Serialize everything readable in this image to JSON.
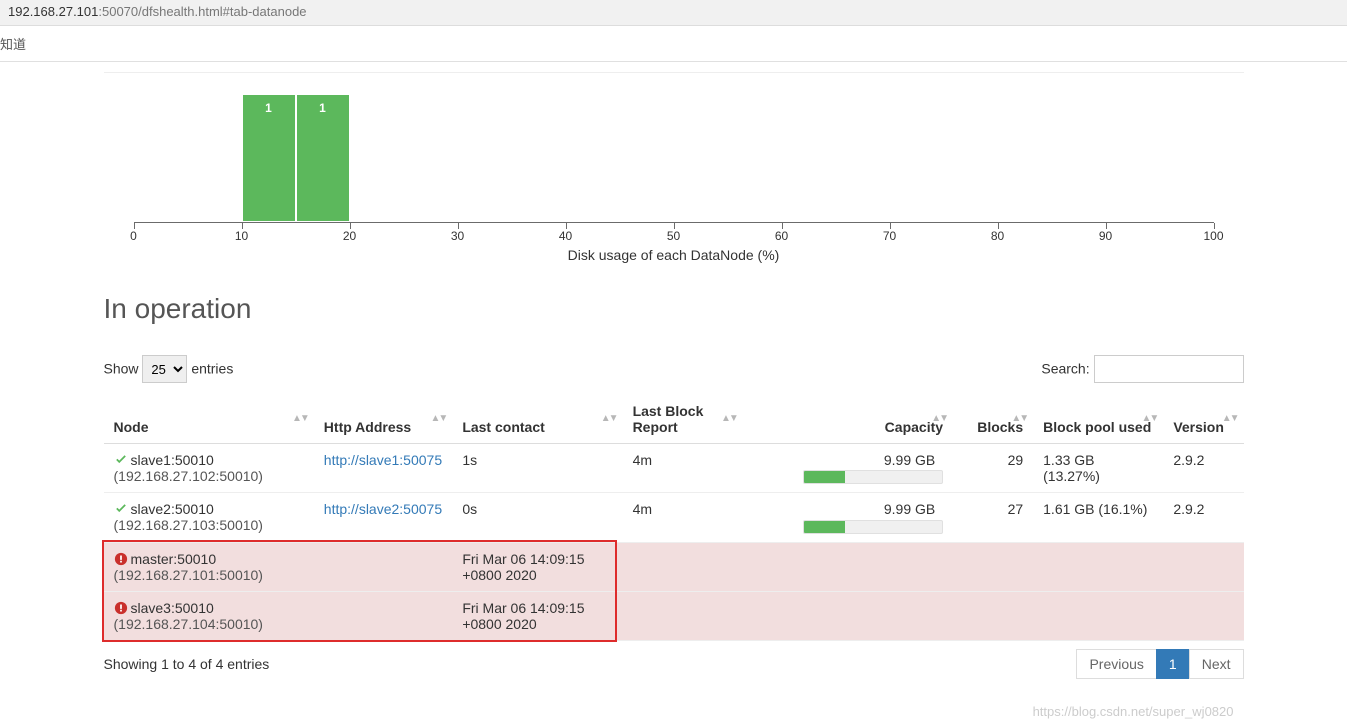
{
  "browser": {
    "url_host": "192.168.27.101",
    "url_path": ":50070/dfshealth.html#tab-datanode",
    "bookmark_fragment": "知道"
  },
  "chart_data": {
    "type": "bar",
    "title": "Disk usage of each DataNode (%)",
    "xlabel": "",
    "ylabel": "",
    "xlim": [
      0,
      100
    ],
    "x_ticks": [
      0,
      10,
      20,
      30,
      40,
      50,
      60,
      70,
      80,
      90,
      100
    ],
    "ylim": [
      0,
      1
    ],
    "bins": [
      {
        "x0": 10,
        "x1": 15,
        "count": 1
      },
      {
        "x0": 15,
        "x1": 20,
        "count": 1
      }
    ]
  },
  "section_title": "In operation",
  "table_controls": {
    "show_label_pre": "Show",
    "show_value": "25",
    "show_label_post": "entries",
    "search_label": "Search:",
    "search_value": ""
  },
  "columns": {
    "node": "Node",
    "http": "Http Address",
    "last_contact": "Last contact",
    "last_block": "Last Block Report",
    "capacity": "Capacity",
    "blocks": "Blocks",
    "bp_used": "Block pool used",
    "version": "Version"
  },
  "rows": [
    {
      "status": "up",
      "node": "slave1:50010",
      "addr": "(192.168.27.102:50010)",
      "http": "http://slave1:50075",
      "last_contact": "1s",
      "last_block": "4m",
      "capacity": "9.99 GB",
      "cap_pct": 30,
      "blocks": "29",
      "bp_used": "1.33 GB (13.27%)",
      "version": "2.9.2"
    },
    {
      "status": "up",
      "node": "slave2:50010",
      "addr": "(192.168.27.103:50010)",
      "http": "http://slave2:50075",
      "last_contact": "0s",
      "last_block": "4m",
      "capacity": "9.99 GB",
      "cap_pct": 30,
      "blocks": "27",
      "bp_used": "1.61 GB (16.1%)",
      "version": "2.9.2"
    },
    {
      "status": "dead",
      "node": "master:50010",
      "addr": "(192.168.27.101:50010)",
      "http": "",
      "last_contact": "Fri Mar 06 14:09:15 +0800 2020",
      "last_block": "",
      "capacity": "",
      "cap_pct": null,
      "blocks": "",
      "bp_used": "",
      "version": ""
    },
    {
      "status": "dead",
      "node": "slave3:50010",
      "addr": "(192.168.27.104:50010)",
      "http": "",
      "last_contact": "Fri Mar 06 14:09:15 +0800 2020",
      "last_block": "",
      "capacity": "",
      "cap_pct": null,
      "blocks": "",
      "bp_used": "",
      "version": ""
    }
  ],
  "pager": {
    "info": "Showing 1 to 4 of 4 entries",
    "previous": "Previous",
    "page": "1",
    "next": "Next"
  },
  "watermark": "https://blog.csdn.net/super_wj0820"
}
